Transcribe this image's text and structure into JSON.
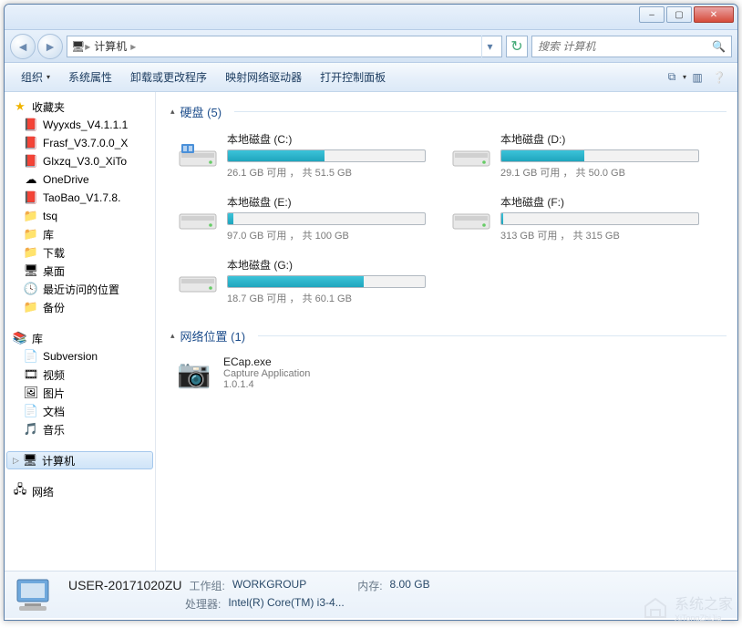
{
  "titlebar": {
    "min": "–",
    "max": "▢",
    "close": "✕"
  },
  "nav": {
    "back": "◄",
    "fwd": "►",
    "path_icon": "🖥",
    "crumb1": "计算机",
    "sep": "▸",
    "dropdown": "▾",
    "refresh": "↻"
  },
  "search": {
    "placeholder": "搜索 计算机",
    "icon": "🔍"
  },
  "toolbar": {
    "organize": "组织",
    "arrow": "▾",
    "props": "系统属性",
    "uninstall": "卸载或更改程序",
    "mapnet": "映射网络驱动器",
    "ctrlpanel": "打开控制面板",
    "view_icon": "⧉",
    "preview_icon": "▥",
    "help_icon": "❔"
  },
  "sidebar": {
    "fav": {
      "label": "收藏夹",
      "icon": "★",
      "items": [
        {
          "icon": "📕",
          "label": "Wyyxds_V4.1.1.1"
        },
        {
          "icon": "📕",
          "label": "Frasf_V3.7.0.0_X"
        },
        {
          "icon": "📕",
          "label": "Glxzq_V3.0_XiTo"
        },
        {
          "icon": "☁",
          "label": "OneDrive"
        },
        {
          "icon": "📕",
          "label": "TaoBao_V1.7.8."
        },
        {
          "icon": "📁",
          "label": "tsq"
        },
        {
          "icon": "📁",
          "label": "库"
        },
        {
          "icon": "📁",
          "label": "下载"
        },
        {
          "icon": "🖥",
          "label": "桌面"
        },
        {
          "icon": "🕓",
          "label": "最近访问的位置"
        },
        {
          "icon": "📁",
          "label": "备份"
        }
      ]
    },
    "lib": {
      "label": "库",
      "icon": "📚",
      "items": [
        {
          "icon": "📄",
          "label": "Subversion"
        },
        {
          "icon": "🎞",
          "label": "视频"
        },
        {
          "icon": "🖼",
          "label": "图片"
        },
        {
          "icon": "📄",
          "label": "文档"
        },
        {
          "icon": "🎵",
          "label": "音乐"
        }
      ]
    },
    "computer": {
      "label": "计算机",
      "icon": "🖥"
    },
    "network": {
      "label": "网络",
      "icon": "🖧"
    }
  },
  "content": {
    "disks_header": "硬盘 (5)",
    "net_header": "网络位置 (1)",
    "drives": [
      {
        "name": "本地磁盘 (C:)",
        "free": "26.1 GB",
        "total": "51.5 GB",
        "used_pct": 49,
        "sys": true
      },
      {
        "name": "本地磁盘 (D:)",
        "free": "29.1 GB",
        "total": "50.0 GB",
        "used_pct": 42
      },
      {
        "name": "本地磁盘 (E:)",
        "free": "97.0 GB",
        "total": "100 GB",
        "used_pct": 3
      },
      {
        "name": "本地磁盘 (F:)",
        "free": "313 GB",
        "total": "315 GB",
        "used_pct": 1
      },
      {
        "name": "本地磁盘 (G:)",
        "free": "18.7 GB",
        "total": "60.1 GB",
        "used_pct": 69
      }
    ],
    "stat_pattern": "{free} 可用 ， 共 {total}",
    "netloc": {
      "name": "ECap.exe",
      "desc": "Capture Application",
      "ver": "1.0.1.4",
      "icon": "📷"
    }
  },
  "status": {
    "name": "USER-20171020ZU",
    "workgroup_label": "工作组:",
    "workgroup": "WORKGROUP",
    "mem_label": "内存:",
    "mem": "8.00 GB",
    "cpu_label": "处理器:",
    "cpu": "Intel(R) Core(TM) i3-4..."
  },
  "watermark": {
    "text": "系统之家",
    "sub": "XiTongZhiJia"
  }
}
